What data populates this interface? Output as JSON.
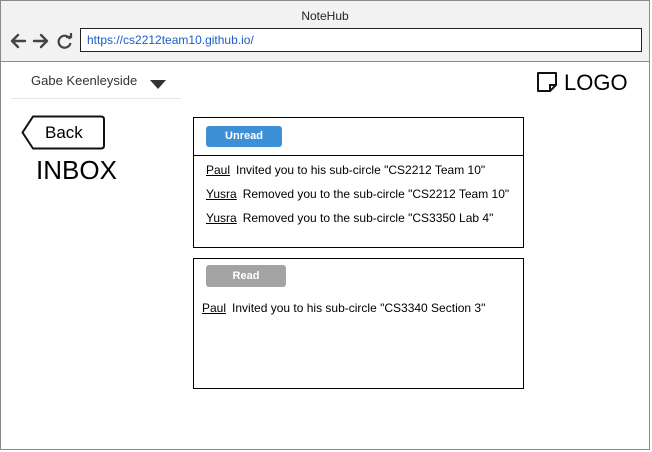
{
  "window": {
    "title": "NoteHub"
  },
  "browser": {
    "url": "https://cs2212team10.github.io/"
  },
  "header": {
    "user_name": "Gabe Keenleyside",
    "logo_text": "LOGO"
  },
  "nav": {
    "back_label": "Back"
  },
  "page": {
    "title": "INBOX"
  },
  "unread": {
    "label": "Unread",
    "items": [
      {
        "sender": "Paul",
        "text": "Invited you to his sub-circle \"CS2212 Team 10\""
      },
      {
        "sender": "Yusra",
        "text": "Removed you to the sub-circle \"CS2212 Team 10\""
      },
      {
        "sender": "Yusra",
        "text": "Removed you to the sub-circle \"CS3350 Lab 4\""
      }
    ]
  },
  "read": {
    "label": "Read",
    "items": [
      {
        "sender": "Paul",
        "text": "Invited you to his sub-circle \"CS3340 Section 3\""
      }
    ]
  },
  "colors": {
    "accent": "#3d8fd6",
    "read_badge": "#a3a3a3",
    "url_text": "#1a5ec4"
  },
  "icons": [
    "back-arrow-icon",
    "forward-arrow-icon",
    "reload-icon",
    "dropdown-caret-icon",
    "logo-icon"
  ]
}
